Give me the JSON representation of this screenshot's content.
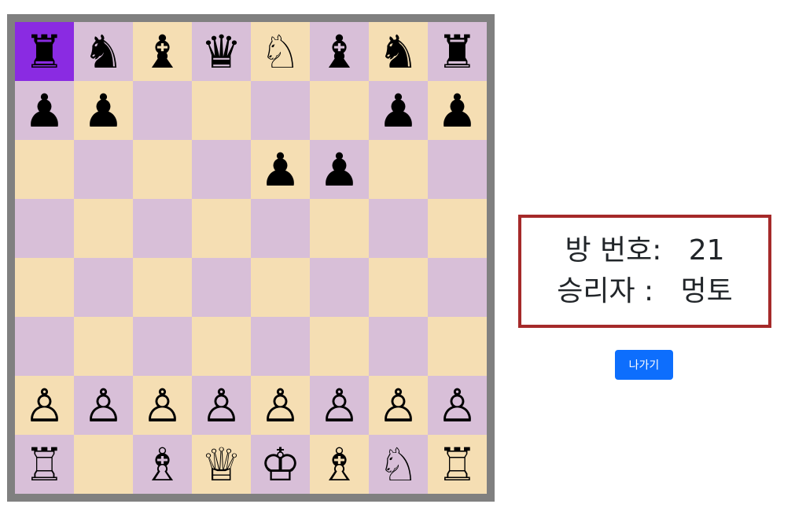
{
  "board": {
    "selected_square": "a8",
    "colors": {
      "light": "#f5deb3",
      "dark": "#d8bfd8",
      "selected": "#8a2be2",
      "frame": "#808080"
    },
    "rows": [
      [
        "♜",
        "♞",
        "♝",
        "♛",
        "♘",
        "♝",
        "♞",
        "♜"
      ],
      [
        "♟",
        "♟",
        "",
        "",
        "",
        "",
        "♟",
        "♟"
      ],
      [
        "",
        "",
        "",
        "",
        "♟",
        "♟",
        "",
        ""
      ],
      [
        "",
        "",
        "",
        "",
        "",
        "",
        "",
        ""
      ],
      [
        "",
        "",
        "",
        "",
        "",
        "",
        "",
        ""
      ],
      [
        "",
        "",
        "",
        "",
        "",
        "",
        "",
        ""
      ],
      [
        "♙",
        "♙",
        "♙",
        "♙",
        "♙",
        "♙",
        "♙",
        "♙"
      ],
      [
        "♖",
        "",
        "♗",
        "♕",
        "♔",
        "♗",
        "♘",
        "♖"
      ]
    ]
  },
  "info": {
    "room_label": "방 번호:   ",
    "room_value": "21",
    "winner_label": "승리자 :   ",
    "winner_value": "멍토",
    "border_color": "#a52a2a"
  },
  "exit_button": {
    "label": "나가기",
    "color": "#0d6efd"
  }
}
